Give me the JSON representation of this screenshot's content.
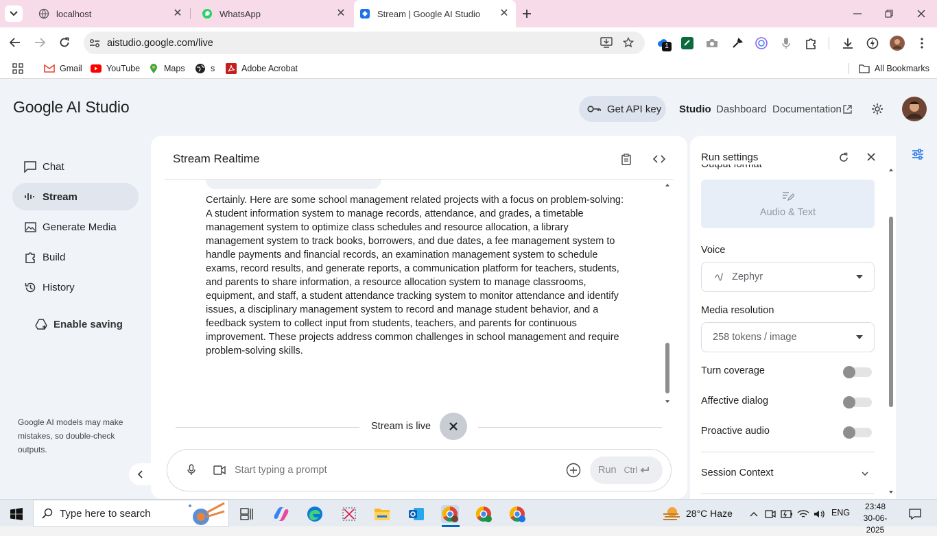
{
  "browser": {
    "tabs": [
      {
        "title": "localhost"
      },
      {
        "title": "WhatsApp"
      },
      {
        "title": "Stream | Google AI Studio"
      }
    ],
    "url": "aistudio.google.com/live",
    "extension_badge": "1",
    "bookmarks": [
      "Gmail",
      "YouTube",
      "Maps",
      "s",
      "Adobe Acrobat"
    ],
    "all_bookmarks": "All Bookmarks"
  },
  "app": {
    "logo": "Google AI Studio",
    "api_key_button": "Get API key",
    "nav": {
      "studio": "Studio",
      "dashboard": "Dashboard",
      "documentation": "Documentation"
    }
  },
  "sidebar": {
    "items": [
      {
        "label": "Chat",
        "icon": "chat-icon"
      },
      {
        "label": "Stream",
        "icon": "waveform-icon"
      },
      {
        "label": "Generate Media",
        "icon": "image-icon"
      },
      {
        "label": "Build",
        "icon": "puzzle-icon"
      },
      {
        "label": "History",
        "icon": "history-icon"
      }
    ],
    "enable_saving": "Enable saving",
    "disclaimer": "Google AI models may make mistakes, so double-check outputs."
  },
  "main": {
    "title": "Stream Realtime",
    "message": "Certainly. Here are some school management related projects with a focus on problem-solving: A student information system to manage records, attendance, and grades, a timetable management system to optimize class schedules and resource allocation, a library management system to track books, borrowers, and due dates, a fee management system to handle payments and financial records, an examination management system to schedule exams, record results, and generate reports, a communication platform for teachers, students, and parents to share information, a resource allocation system to manage classrooms, equipment, and staff, a student attendance tracking system to monitor attendance and identify issues, a disciplinary management system to record and manage student behavior, and a feedback system to collect input from students, teachers, and parents for continuous improvement. These projects address common challenges in school management and require problem-solving skills.",
    "stream_status": "Stream is live",
    "prompt_placeholder": "Start typing a prompt",
    "run_label": "Run",
    "run_shortcut": "Ctrl"
  },
  "settings": {
    "title": "Run settings",
    "output_format_label": "Output format",
    "output_format_value": "Audio & Text",
    "voice_label": "Voice",
    "voice_value": "Zephyr",
    "media_resolution_label": "Media resolution",
    "media_resolution_value": "258 tokens / image",
    "turn_coverage": "Turn coverage",
    "affective_dialog": "Affective dialog",
    "proactive_audio": "Proactive audio",
    "session_context": "Session Context"
  },
  "taskbar": {
    "search_placeholder": "Type here to search",
    "weather": "28°C  Haze",
    "language": "ENG",
    "time": "23:48",
    "date": "30-06-2025"
  }
}
